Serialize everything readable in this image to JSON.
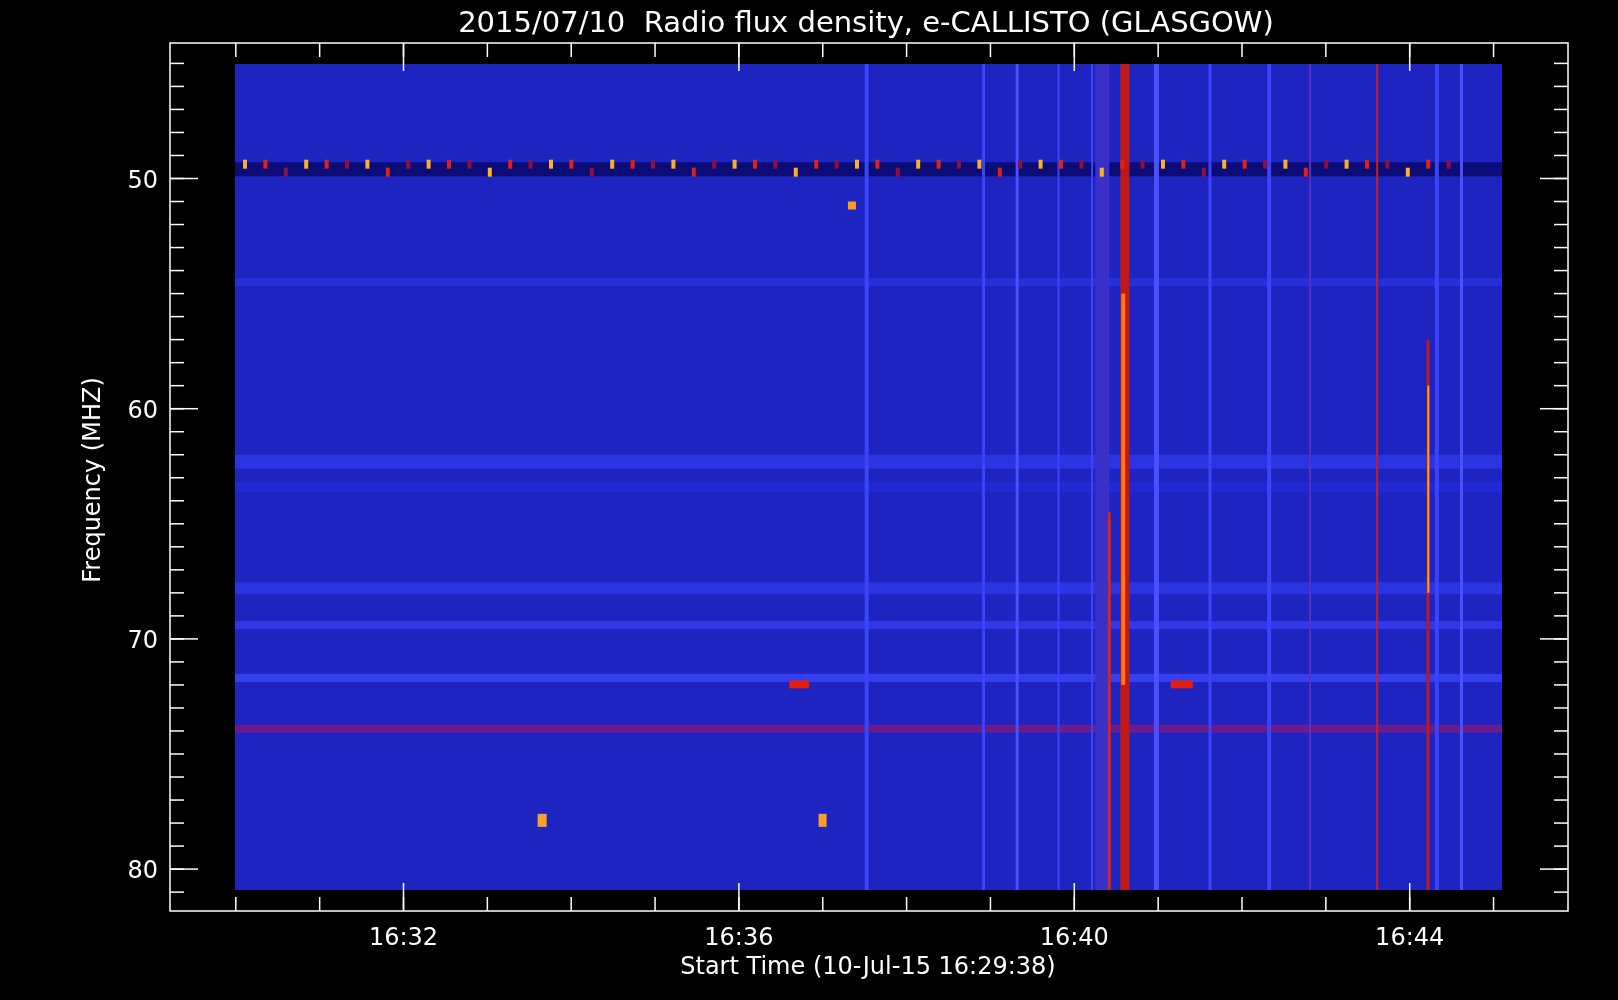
{
  "title": "2015/07/10  Radio flux density, e-CALLISTO (GLASGOW)",
  "y_axis": {
    "label": "Frequency (MHZ)",
    "ticks": [
      "50",
      "60",
      "70",
      "80"
    ]
  },
  "x_axis": {
    "label": "Start Time (10-Jul-15 16:29:38)",
    "ticks": [
      "16:32",
      "16:36",
      "16:40",
      "16:44"
    ]
  }
}
